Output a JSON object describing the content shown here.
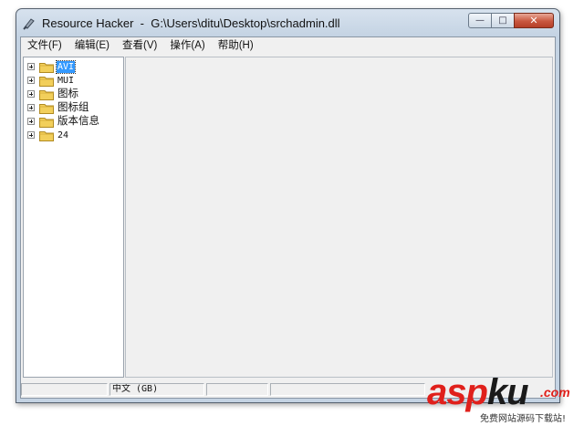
{
  "window": {
    "title": "Resource Hacker  -  G:\\Users\\ditu\\Desktop\\srchadmin.dll",
    "minimize_glyph": "—",
    "maximize_glyph": "□",
    "close_glyph": "✕"
  },
  "menu": [
    {
      "label": "文件(F)"
    },
    {
      "label": "编辑(E)"
    },
    {
      "label": "查看(V)"
    },
    {
      "label": "操作(A)"
    },
    {
      "label": "帮助(H)"
    }
  ],
  "tree": {
    "nodes": [
      {
        "label": "AVI",
        "selected": true
      },
      {
        "label": "MUI"
      },
      {
        "label": "图标"
      },
      {
        "label": "图标组"
      },
      {
        "label": "版本信息"
      },
      {
        "label": "24"
      }
    ]
  },
  "status": {
    "panels": [
      "",
      "中文 (GB)",
      "",
      ""
    ]
  },
  "watermark": {
    "brand_asp": "asp",
    "brand_ku": "ku",
    "tld": ".com",
    "tagline": "免费网站源码下载站!"
  },
  "colors": {
    "selection": "#3399ff",
    "folder": "#f2cf5b",
    "watermark_red": "#e0201b"
  }
}
